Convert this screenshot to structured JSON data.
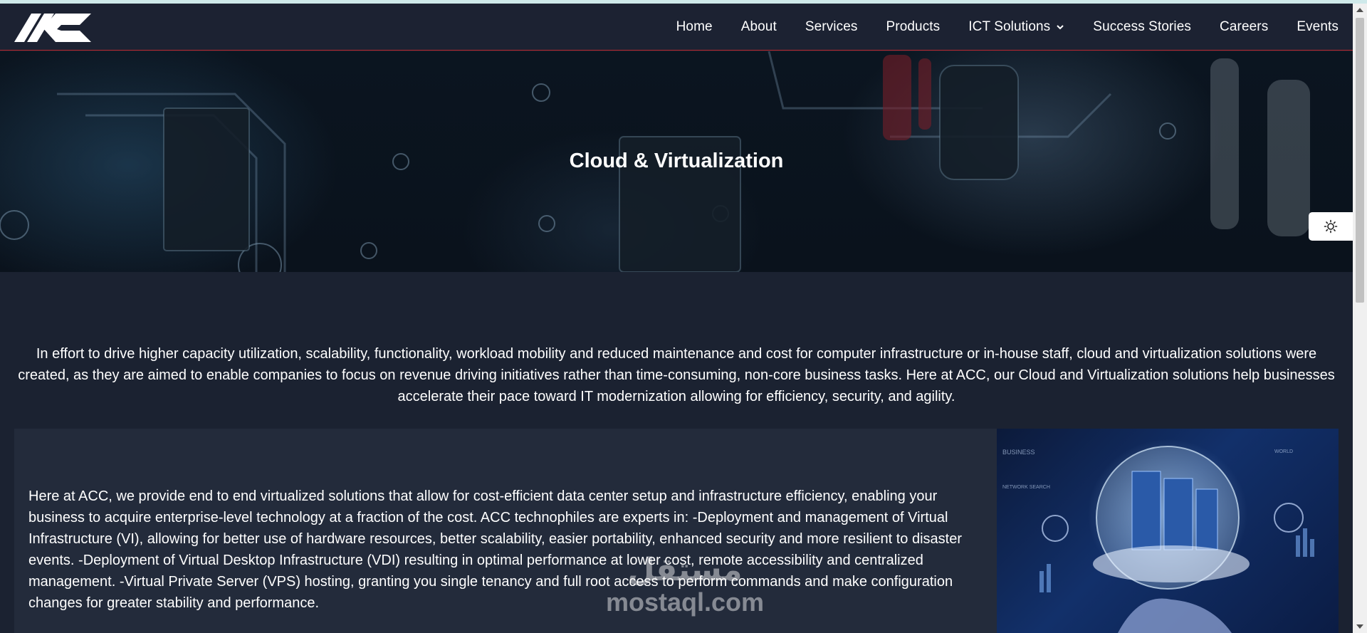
{
  "nav": {
    "items": [
      {
        "label": "Home"
      },
      {
        "label": "About"
      },
      {
        "label": "Services"
      },
      {
        "label": "Products"
      },
      {
        "label": "ICT Solutions",
        "has_dropdown": true
      },
      {
        "label": "Success Stories"
      },
      {
        "label": "Careers"
      },
      {
        "label": "Events"
      }
    ]
  },
  "hero": {
    "title": "Cloud & Virtualization"
  },
  "intro": {
    "text": "In effort to drive higher capacity utilization, scalability, functionality, workload mobility and reduced maintenance and cost for computer infrastructure or in-house staff, cloud and virtualization solutions were created, as they are aimed to enable companies to focus on revenue driving initiatives rather than time-consuming, non-core business tasks. Here at ACC, our Cloud and Virtualization solutions help businesses accelerate their pace toward IT modernization allowing for efficiency, security, and agility."
  },
  "card": {
    "text": "Here at ACC, we provide end to end virtualized solutions that allow for cost-efficient data center setup and infrastructure efficiency, enabling your business to acquire enterprise-level technology at a fraction of the cost. ACC technophiles are experts in: -Deployment and management of Virtual Infrastructure (VI), allowing for better use of hardware resources, better scalability, easier portability, enhanced security and more resilient to disaster events. -Deployment of Virtual Desktop Infrastructure (VDI) resulting in optimal performance at lower cost, remote accessibility and centralized management. -Virtual Private Server (VPS) hosting, granting you single tenancy and full root access to perform commands and make configuration changes for greater stability and performance.",
    "image_overlay_labels": [
      "BUSINESS",
      "NETWORK SEARCH",
      "WORLD"
    ]
  },
  "watermark": {
    "arabic": "مستقل",
    "latin": "mostaql.com"
  },
  "colors": {
    "page_bg": "#1b2231",
    "navbar_bg": "#1c2232",
    "nav_border": "#b8262d",
    "card_bg": "#232b3b",
    "top_strip": "#cfe9ea"
  },
  "icons": {
    "logo": "acc-logo",
    "dropdown": "chevron-down-icon",
    "theme": "sun-icon"
  }
}
